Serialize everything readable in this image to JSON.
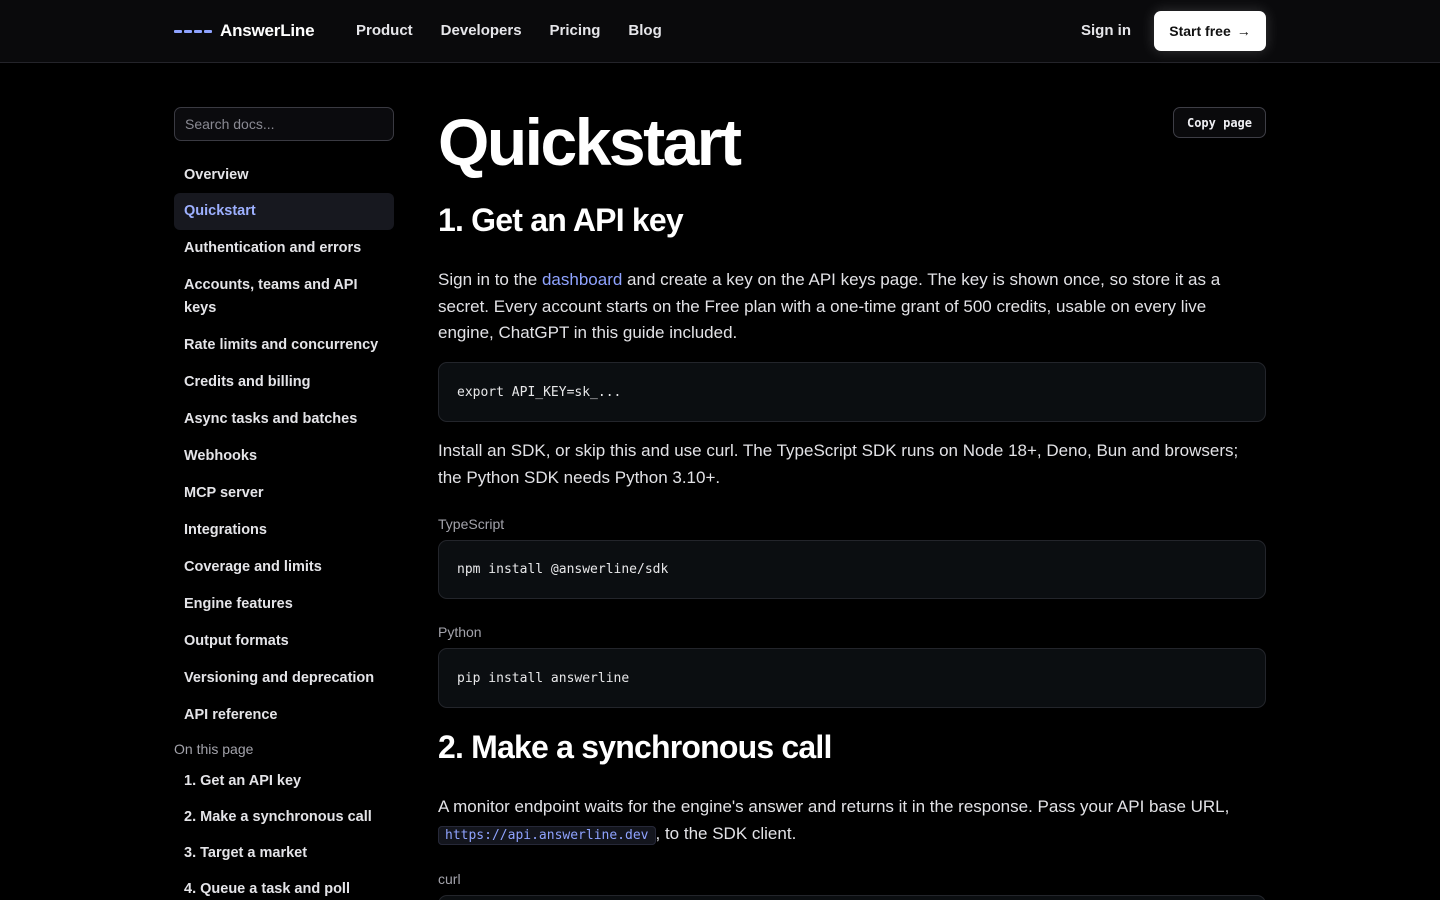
{
  "header": {
    "brand": "AnswerLine",
    "nav": [
      "Product",
      "Developers",
      "Pricing",
      "Blog"
    ],
    "sign_in": "Sign in",
    "start_free": "Start free",
    "start_arrow": "→"
  },
  "sidebar": {
    "search_placeholder": "Search docs...",
    "items": [
      {
        "label": "Overview"
      },
      {
        "label": "Quickstart",
        "active": true
      },
      {
        "label": "Authentication and errors"
      },
      {
        "label": "Accounts, teams and API keys"
      },
      {
        "label": "Rate limits and concurrency"
      },
      {
        "label": "Credits and billing"
      },
      {
        "label": "Async tasks and batches"
      },
      {
        "label": "Webhooks"
      },
      {
        "label": "MCP server"
      },
      {
        "label": "Integrations"
      },
      {
        "label": "Coverage and limits"
      },
      {
        "label": "Engine features"
      },
      {
        "label": "Output formats"
      },
      {
        "label": "Versioning and deprecation"
      },
      {
        "label": "API reference"
      }
    ],
    "on_this_page_title": "On this page",
    "on_this_page": [
      "1. Get an API key",
      "2. Make a synchronous call",
      "3. Target a market",
      "4. Queue a task and poll"
    ]
  },
  "main": {
    "copy_page": "Copy page",
    "title": "Quickstart",
    "section1_title": "1. Get an API key",
    "p1_before": "Sign in to the ",
    "p1_link": "dashboard",
    "p1_after": " and create a key on the API keys page. The key is shown once, so store it as a secret. Every account starts on the Free plan with a one-time grant of 500 credits, usable on every live engine, ChatGPT in this guide included.",
    "code1": "export API_KEY=sk_...",
    "p2": "Install an SDK, or skip this and use curl. The TypeScript SDK runs on Node 18+, Deno, Bun and browsers; the Python SDK needs Python 3.10+.",
    "label_ts": "TypeScript",
    "code_ts": "npm install @answerline/sdk",
    "label_py": "Python",
    "code_py": "pip install answerline",
    "section2_title": "2. Make a synchronous call",
    "p3_before": "A monitor endpoint waits for the engine's answer and returns it in the response. Pass your API base URL,",
    "p3_code": "https://api.answerline.dev",
    "p3_after": ", to the SDK client.",
    "label_curl": "curl"
  }
}
